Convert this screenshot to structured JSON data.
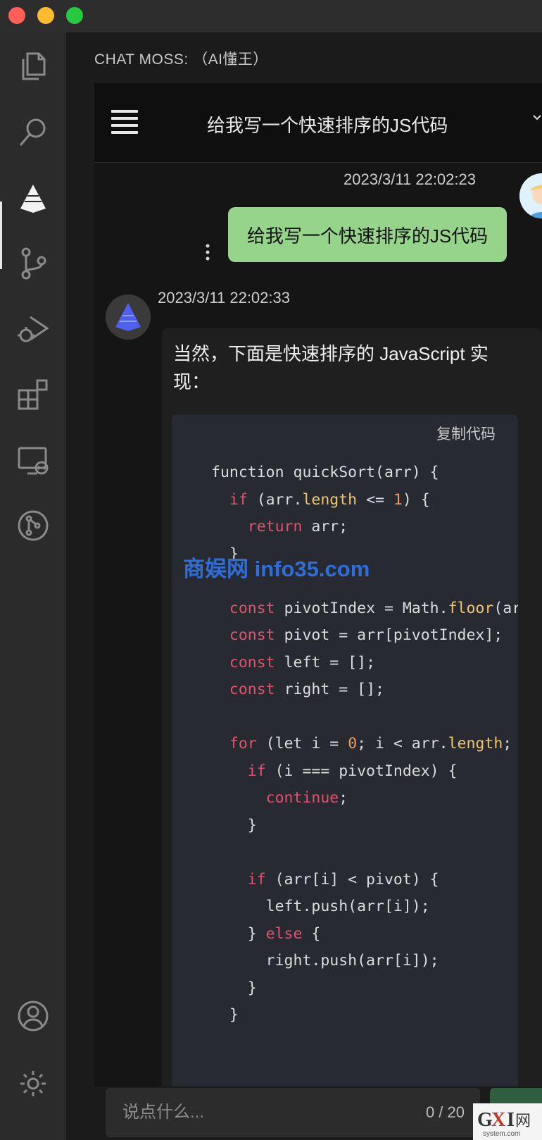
{
  "window": {
    "traffic_lights": [
      "close",
      "minimize",
      "zoom"
    ]
  },
  "activity_bar": {
    "icons": [
      "files-icon",
      "search-icon",
      "chatmoss-icon",
      "source-control-icon",
      "run-debug-icon",
      "extensions-icon",
      "remote-explorer-icon",
      "git-graph-icon",
      "account-icon",
      "settings-gear-icon"
    ]
  },
  "panel": {
    "title": "CHAT MOSS: （AI懂王）"
  },
  "chat": {
    "header_title": "给我写一个快速排序的JS代码",
    "user_message": {
      "timestamp": "2023/3/11 22:02:23",
      "text": "给我写一个快速排序的JS代码"
    },
    "bot_message": {
      "timestamp": "2023/3/11 22:02:33",
      "text": "当然，下面是快速排序的 JavaScript 实现：",
      "copy_label": "复制代码"
    },
    "input": {
      "placeholder": "说点什么...",
      "counter": "0 / 20"
    }
  },
  "watermark": "商娱网 info35.com",
  "corner_logo": "GXI网 system.com"
}
